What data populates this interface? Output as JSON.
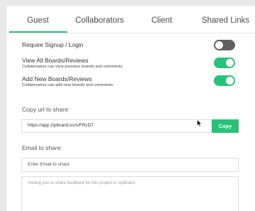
{
  "tabs": [
    {
      "label": "Guest",
      "active": true
    },
    {
      "label": "Collaborators",
      "active": false
    },
    {
      "label": "Client",
      "active": false
    },
    {
      "label": "Shared Links",
      "active": false
    }
  ],
  "settings": [
    {
      "label": "Require Signup / Login",
      "description": "",
      "enabled": false
    },
    {
      "label": "View All Boards/Reviews",
      "description": "Collaborators can view previous boards and comments.",
      "enabled": true
    },
    {
      "label": "Add New Boards/Reviews",
      "description": "Collaborators can add new boards and comments.",
      "enabled": true
    }
  ],
  "copy_url": {
    "label": "Copy url to share:",
    "value": "https://app.zipboard.co/s/FRcD7",
    "button_label": "Copy"
  },
  "email": {
    "label": "Email to share:",
    "placeholder": "Enter Email to share",
    "message": "Inviting you to share feedback for this project in zipBoard."
  },
  "colors": {
    "accent": "#27c277",
    "toggle_off": "#5f5f5f",
    "background": "#e9e9e9",
    "panel": "#ffffff"
  },
  "icons": {
    "cursor": "mouse-pointer-icon"
  }
}
